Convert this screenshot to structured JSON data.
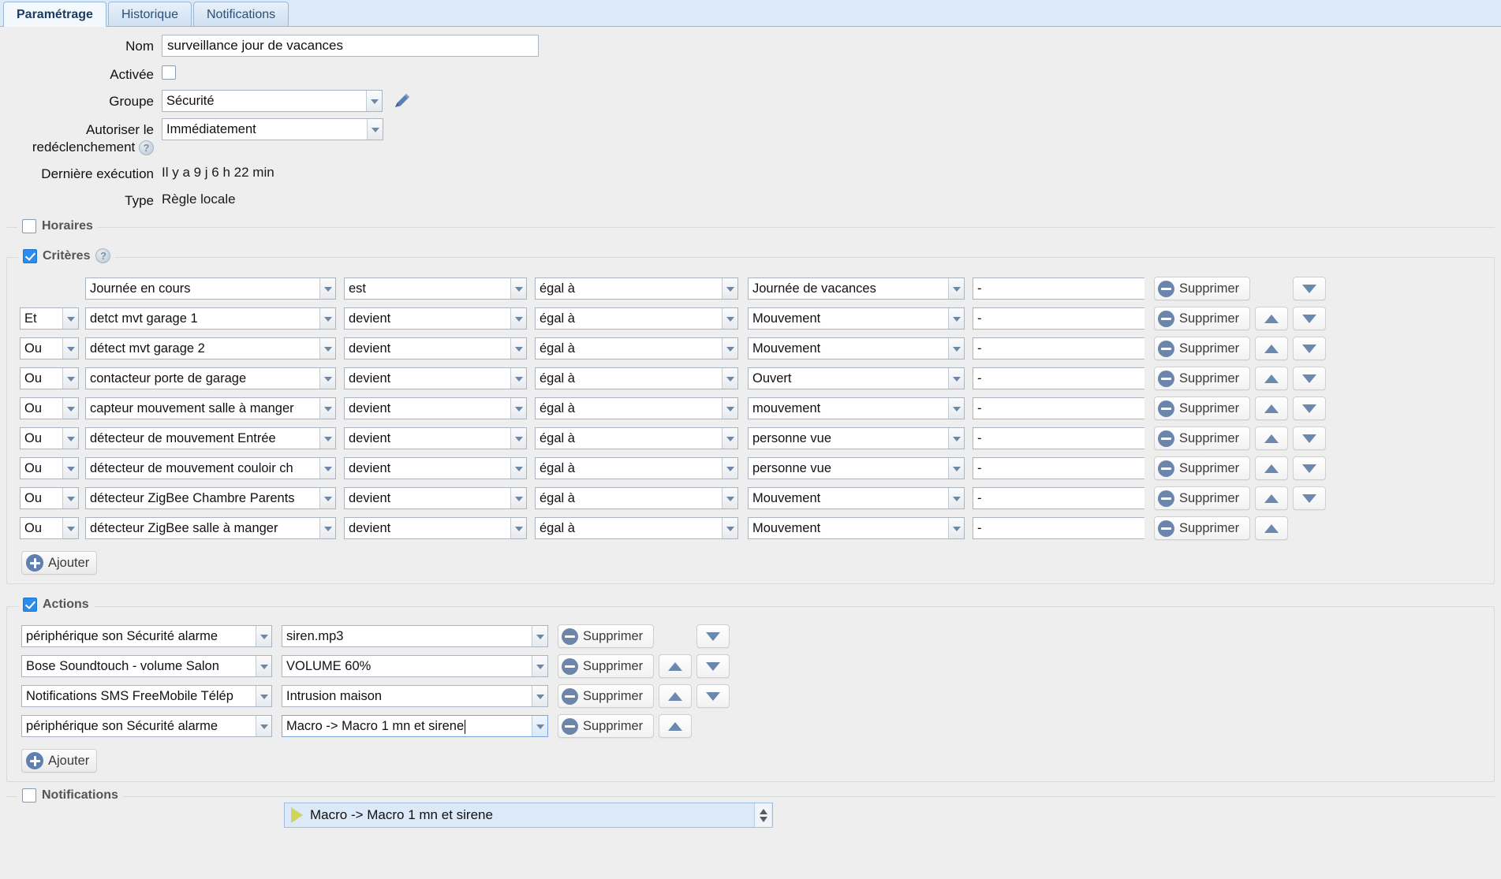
{
  "tabs": [
    {
      "label": "Paramétrage",
      "active": true
    },
    {
      "label": "Historique",
      "active": false
    },
    {
      "label": "Notifications",
      "active": false
    }
  ],
  "form": {
    "nom_label": "Nom",
    "nom_value": "surveillance jour de vacances",
    "activee_label": "Activée",
    "activee_checked": false,
    "groupe_label": "Groupe",
    "groupe_value": "Sécurité",
    "retrigger_label_line1": "Autoriser le",
    "retrigger_label_line2": "redéclenchement",
    "retrigger_value": "Immédiatement",
    "derniere_execution_label": "Dernière exécution",
    "derniere_execution_value": "Il y a 9 j 6 h 22 min",
    "type_label": "Type",
    "type_value": "Règle locale"
  },
  "sections": {
    "horaires": {
      "label": "Horaires",
      "checked": false
    },
    "criteres": {
      "label": "Critères",
      "checked": true
    },
    "actions": {
      "label": "Actions",
      "checked": true
    },
    "notifications": {
      "label": "Notifications",
      "checked": false
    }
  },
  "buttons": {
    "supprimer": "Supprimer",
    "ajouter": "Ajouter"
  },
  "criteria": [
    {
      "op": "",
      "device": "Journée en cours",
      "verb": "est",
      "cmp": "égal à",
      "value": "Journée de vacances",
      "opt": "-",
      "up": false,
      "down": true
    },
    {
      "op": "Et",
      "device": "detct mvt garage 1",
      "verb": "devient",
      "cmp": "égal à",
      "value": "Mouvement",
      "opt": "-",
      "up": true,
      "down": true
    },
    {
      "op": "Ou",
      "device": "détect mvt garage 2",
      "verb": "devient",
      "cmp": "égal à",
      "value": "Mouvement",
      "opt": "-",
      "up": true,
      "down": true
    },
    {
      "op": "Ou",
      "device": "contacteur porte de garage",
      "verb": "devient",
      "cmp": "égal à",
      "value": "Ouvert",
      "opt": "-",
      "up": true,
      "down": true
    },
    {
      "op": "Ou",
      "device": "capteur mouvement salle à manger",
      "verb": "devient",
      "cmp": "égal à",
      "value": "mouvement",
      "opt": "-",
      "up": true,
      "down": true
    },
    {
      "op": "Ou",
      "device": "détecteur de mouvement Entrée",
      "verb": "devient",
      "cmp": "égal à",
      "value": "personne vue",
      "opt": "-",
      "up": true,
      "down": true
    },
    {
      "op": "Ou",
      "device": "détecteur de mouvement couloir ch",
      "verb": "devient",
      "cmp": "égal à",
      "value": "personne vue",
      "opt": "-",
      "up": true,
      "down": true
    },
    {
      "op": "Ou",
      "device": "détecteur ZigBee Chambre Parents",
      "verb": "devient",
      "cmp": "égal à",
      "value": "Mouvement",
      "opt": "-",
      "up": true,
      "down": true
    },
    {
      "op": "Ou",
      "device": "détecteur ZigBee salle à manger",
      "verb": "devient",
      "cmp": "égal à",
      "value": "Mouvement",
      "opt": "-",
      "up": true,
      "down": false
    }
  ],
  "actions": [
    {
      "device": "périphérique son Sécurité alarme",
      "command": "siren.mp3",
      "up": false,
      "down": true,
      "focused": false
    },
    {
      "device": "Bose Soundtouch - volume Salon",
      "command": "VOLUME 60%",
      "up": true,
      "down": true,
      "focused": false
    },
    {
      "device": "Notifications SMS FreeMobile Télép",
      "command": "Intrusion maison",
      "up": true,
      "down": true,
      "focused": false
    },
    {
      "device": "périphérique son Sécurité alarme",
      "command": "Macro -> Macro 1 mn et sirene",
      "up": true,
      "down": false,
      "focused": true
    }
  ],
  "autocomplete": {
    "suggestion": "Macro -> Macro 1 mn et sirene"
  },
  "colors": {
    "tab_active_bg": "#f3f8fd",
    "tab_bar_bg": "#dce9f7",
    "page_bg": "#eeeeee",
    "checkbox_checked": "#2b8cf0",
    "button_icon": "#6c86ab",
    "autocomplete_bg": "#dce9f9"
  }
}
